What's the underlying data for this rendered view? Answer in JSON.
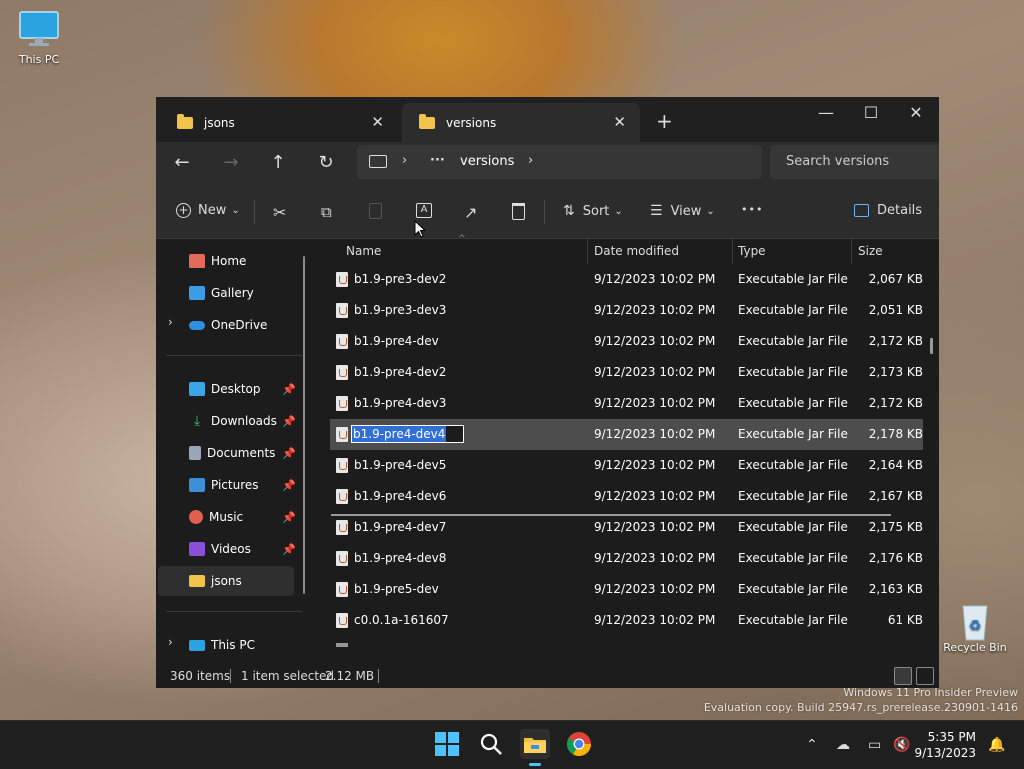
{
  "desktop": {
    "this_pc_label": "This PC",
    "recycle_bin_label": "Recycle Bin",
    "watermark_line1": "Windows 11 Pro Insider Preview",
    "watermark_line2": "Evaluation copy. Build 25947.rs_prerelease.230901-1416"
  },
  "tabs": [
    {
      "label": "jsons",
      "active": false
    },
    {
      "label": "versions",
      "active": true
    }
  ],
  "window_controls": {
    "minimize": "—",
    "maximize": "☐",
    "close": "✕"
  },
  "address": {
    "ellipsis": "···",
    "current": "versions",
    "search_placeholder": "Search versions"
  },
  "toolbar": {
    "new_label": "New",
    "sort_label": "Sort",
    "view_label": "View",
    "more_label": "•••",
    "details_label": "Details"
  },
  "nav": {
    "home": "Home",
    "gallery": "Gallery",
    "onedrive": "OneDrive",
    "desktop": "Desktop",
    "downloads": "Downloads",
    "documents": "Documents",
    "pictures": "Pictures",
    "music": "Music",
    "videos": "Videos",
    "jsons": "jsons",
    "this_pc": "This PC"
  },
  "columns": {
    "name": "Name",
    "date": "Date modified",
    "type": "Type",
    "size": "Size"
  },
  "files": [
    {
      "name": "b1.9-pre3-dev2",
      "date": "9/12/2023 10:02 PM",
      "type": "Executable Jar File",
      "size": "2,067 KB"
    },
    {
      "name": "b1.9-pre3-dev3",
      "date": "9/12/2023 10:02 PM",
      "type": "Executable Jar File",
      "size": "2,051 KB"
    },
    {
      "name": "b1.9-pre4-dev",
      "date": "9/12/2023 10:02 PM",
      "type": "Executable Jar File",
      "size": "2,172 KB"
    },
    {
      "name": "b1.9-pre4-dev2",
      "date": "9/12/2023 10:02 PM",
      "type": "Executable Jar File",
      "size": "2,173 KB"
    },
    {
      "name": "b1.9-pre4-dev3",
      "date": "9/12/2023 10:02 PM",
      "type": "Executable Jar File",
      "size": "2,172 KB"
    },
    {
      "name": "b1.9-pre4-dev4",
      "date": "9/12/2023 10:02 PM",
      "type": "Executable Jar File",
      "size": "2,178 KB"
    },
    {
      "name": "b1.9-pre4-dev5",
      "date": "9/12/2023 10:02 PM",
      "type": "Executable Jar File",
      "size": "2,164 KB"
    },
    {
      "name": "b1.9-pre4-dev6",
      "date": "9/12/2023 10:02 PM",
      "type": "Executable Jar File",
      "size": "2,167 KB"
    },
    {
      "name": "b1.9-pre4-dev7",
      "date": "9/12/2023 10:02 PM",
      "type": "Executable Jar File",
      "size": "2,175 KB"
    },
    {
      "name": "b1.9-pre4-dev8",
      "date": "9/12/2023 10:02 PM",
      "type": "Executable Jar File",
      "size": "2,176 KB"
    },
    {
      "name": "b1.9-pre5-dev",
      "date": "9/12/2023 10:02 PM",
      "type": "Executable Jar File",
      "size": "2,163 KB"
    },
    {
      "name": "c0.0.1a-161607",
      "date": "9/12/2023 10:02 PM",
      "type": "Executable Jar File",
      "size": "61 KB"
    }
  ],
  "selected_index": 5,
  "rename_value": "b1.9-pre4-dev4",
  "status": {
    "items": "360 items",
    "selected": "1 item selected",
    "size": "2.12 MB"
  },
  "taskbar": {
    "time": "5:35 PM",
    "date": "9/13/2023"
  }
}
